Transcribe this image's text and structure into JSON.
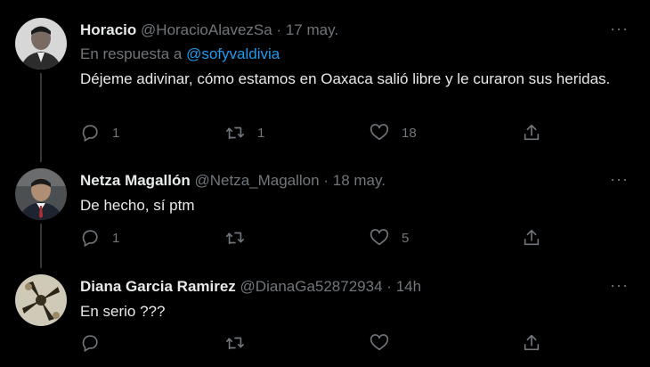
{
  "tweets": [
    {
      "name": "Horacio",
      "handle": "@HoracioAlavezSa",
      "date": "17 may.",
      "reply_label": "En respuesta a",
      "reply_handle": "@sofyvaldivia",
      "text": "Déjeme adivinar, cómo estamos en Oaxaca salió libre y le curaron sus heridas.",
      "replies": "1",
      "retweets": "1",
      "likes": "18"
    },
    {
      "name": "Netza Magallón",
      "handle": "@Netza_Magallon",
      "date": "18 may.",
      "text": "De hecho, sí ptm",
      "replies": "1",
      "retweets": "",
      "likes": "5"
    },
    {
      "name": "Diana Garcia Ramirez",
      "handle": "@DianaGa52872934",
      "date": "14h",
      "text": "En serio ???",
      "replies": "",
      "retweets": "",
      "likes": ""
    }
  ],
  "separator": "·",
  "more_label": "···",
  "icons": [
    "reply-icon",
    "retweet-icon",
    "like-icon",
    "share-icon"
  ],
  "colors": {
    "background": "#000000",
    "text": "#e7e9ea",
    "muted": "#71767b",
    "link": "#1d9bf0"
  }
}
